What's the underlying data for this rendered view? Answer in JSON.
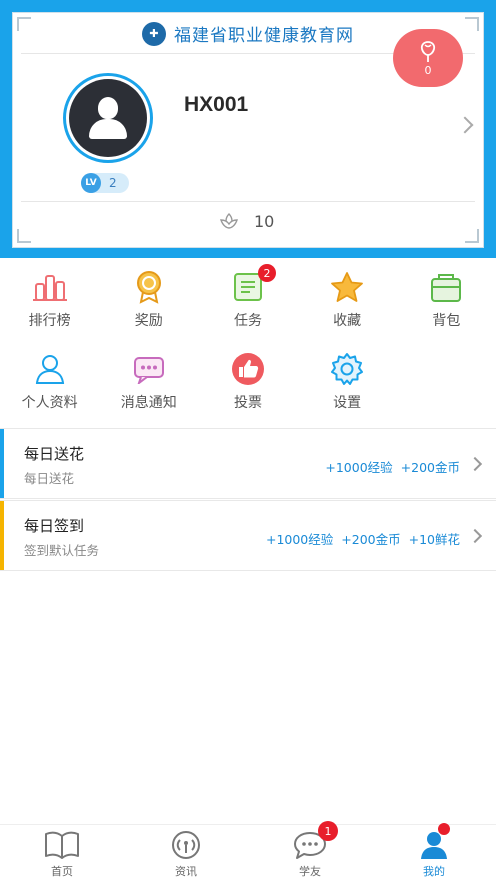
{
  "header": {
    "site_title": "福建省职业健康教育网",
    "username": "HX001",
    "level_badge": "LV",
    "level": "2",
    "flowers": "0",
    "likes": "10"
  },
  "menu": [
    {
      "label": "排行榜",
      "icon": "ranking-icon"
    },
    {
      "label": "奖励",
      "icon": "award-icon"
    },
    {
      "label": "任务",
      "icon": "task-icon",
      "badge": "2"
    },
    {
      "label": "收藏",
      "icon": "star-icon"
    },
    {
      "label": "背包",
      "icon": "backpack-icon"
    },
    {
      "label": "个人资料",
      "icon": "profile-icon"
    },
    {
      "label": "消息通知",
      "icon": "message-icon"
    },
    {
      "label": "投票",
      "icon": "vote-icon"
    },
    {
      "label": "设置",
      "icon": "gear-icon"
    }
  ],
  "tasks": [
    {
      "title": "每日送花",
      "subtitle": "每日送花",
      "rewards": [
        "+1000经验",
        "+200金币"
      ],
      "accent": "#1aa3ea"
    },
    {
      "title": "每日签到",
      "subtitle": "签到默认任务",
      "rewards": [
        "+1000经验",
        "+200金币",
        "+10鲜花"
      ],
      "accent": "#f5b400"
    }
  ],
  "tabbar": [
    {
      "label": "首页",
      "icon": "book-icon"
    },
    {
      "label": "资讯",
      "icon": "broadcast-icon"
    },
    {
      "label": "学友",
      "icon": "chat-icon",
      "badge": "1"
    },
    {
      "label": "我的",
      "icon": "user-icon",
      "active": true
    }
  ],
  "colors": {
    "primary": "#1aa3ea",
    "badge": "#e81e2b",
    "flower": "#f26a6e",
    "sign_in_accent": "#f5b400"
  }
}
